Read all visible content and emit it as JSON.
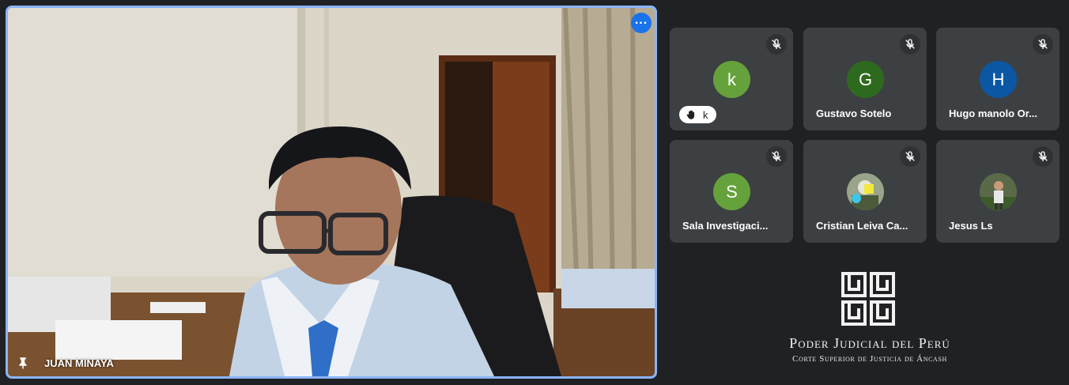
{
  "main": {
    "speaker_name": "JUAN MINAYA",
    "more_icon": "more-horiz-icon",
    "pin_icon": "pin-icon",
    "border_color": "#8ab4f8"
  },
  "participants": [
    {
      "name": "k",
      "initial": "k",
      "avatar_color": "#66a23b",
      "hand_raised": true,
      "muted": true
    },
    {
      "name": "Gustavo Sotelo",
      "initial": "G",
      "avatar_color": "#2e6a1e",
      "hand_raised": false,
      "muted": true
    },
    {
      "name": "Hugo manolo Or...",
      "initial": "H",
      "avatar_color": "#0b57a4",
      "hand_raised": false,
      "muted": true
    },
    {
      "name": "Sala Investigaci...",
      "initial": "S",
      "avatar_color": "#66a23b",
      "hand_raised": false,
      "muted": true
    },
    {
      "name": "Cristian Leiva Ca...",
      "initial": "",
      "avatar_color": "#7a8a6a",
      "hand_raised": false,
      "muted": true
    },
    {
      "name": "Jesus Ls",
      "initial": "",
      "avatar_color": "#5a6a4a",
      "hand_raised": false,
      "muted": true
    }
  ],
  "hand_chip": {
    "label": "k",
    "icon": "raised-hand-icon"
  },
  "logo": {
    "title": "Poder Judicial del Perú",
    "subtitle": "Corte Superior de Justicia de Áncash"
  }
}
